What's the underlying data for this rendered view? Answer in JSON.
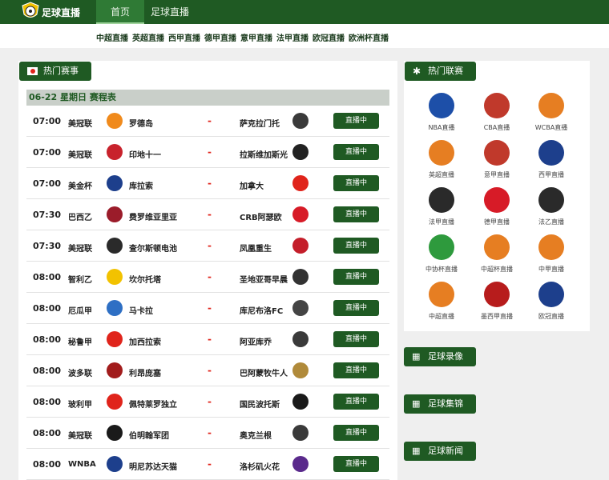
{
  "header": {
    "logo_text": "足球直播",
    "nav": [
      "首页",
      "足球直播"
    ]
  },
  "subnav": [
    "中超直播",
    "英超直播",
    "西甲直播",
    "德甲直播",
    "意甲直播",
    "法甲直播",
    "欧冠直播",
    "欧洲杯直播"
  ],
  "hot_matches": {
    "title": "热门赛事",
    "date": "06-22 星期日 赛程表",
    "live_label": "直播中",
    "rows": [
      {
        "time": "07:00",
        "league": "美冠联",
        "home": "罗德岛",
        "away": "萨克拉门托",
        "hcolor": "#f08a1c",
        "acolor": "#3a3a3a"
      },
      {
        "time": "07:00",
        "league": "美冠联",
        "home": "印地十一",
        "away": "拉斯维加斯光",
        "hcolor": "#c8222c",
        "acolor": "#222222"
      },
      {
        "time": "07:00",
        "league": "美金杯",
        "home": "库拉索",
        "away": "加拿大",
        "hcolor": "#1d3f8c",
        "acolor": "#e0241b"
      },
      {
        "time": "07:30",
        "league": "巴西乙",
        "home": "费罗维亚里亚",
        "away": "CRB阿瑟欧",
        "hcolor": "#9b1c2a",
        "acolor": "#d71b27"
      },
      {
        "time": "07:30",
        "league": "美冠联",
        "home": "查尔斯顿电池",
        "away": "凤凰重生",
        "hcolor": "#2a2a2a",
        "acolor": "#c41e2a"
      },
      {
        "time": "08:00",
        "league": "智利乙",
        "home": "坎尔托塔",
        "away": "圣地亚哥早晨",
        "hcolor": "#f2c200",
        "acolor": "#333333"
      },
      {
        "time": "08:00",
        "league": "厄瓜甲",
        "home": "马卡拉",
        "away": "库尼布洛FC",
        "hcolor": "#2e6fc4",
        "acolor": "#444444"
      },
      {
        "time": "08:00",
        "league": "秘鲁甲",
        "home": "加西拉索",
        "away": "阿亚库乔",
        "hcolor": "#e0241b",
        "acolor": "#3a3a3a"
      },
      {
        "time": "08:00",
        "league": "波多联",
        "home": "利昂庞塞",
        "away": "巴阿蒙牧牛人",
        "hcolor": "#a21c1c",
        "acolor": "#b08a3a"
      },
      {
        "time": "08:00",
        "league": "玻利甲",
        "home": "佩特莱罗独立",
        "away": "国民波托斯",
        "hcolor": "#e0241b",
        "acolor": "#1a1a1a"
      },
      {
        "time": "08:00",
        "league": "美冠联",
        "home": "伯明翰军团",
        "away": "奥克兰根",
        "hcolor": "#1a1a1a",
        "acolor": "#3a3a3a"
      },
      {
        "time": "08:00",
        "league": "WNBA",
        "home": "明尼苏达天猫",
        "away": "洛杉矶火花",
        "hcolor": "#1d3f8c",
        "acolor": "#5a2a8c"
      }
    ]
  },
  "hot_leagues": {
    "title": "热门联赛",
    "items": [
      {
        "label": "NBA直播",
        "color": "#1d4fa8"
      },
      {
        "label": "CBA直播",
        "color": "#c0392b"
      },
      {
        "label": "WCBA直播",
        "color": "#e67e22"
      },
      {
        "label": "英超直播",
        "color": "#e67e22"
      },
      {
        "label": "意甲直播",
        "color": "#c0392b"
      },
      {
        "label": "西甲直播",
        "color": "#1d3f8c"
      },
      {
        "label": "法甲直播",
        "color": "#2a2a2a"
      },
      {
        "label": "德甲直播",
        "color": "#d71b27"
      },
      {
        "label": "法乙直播",
        "color": "#2a2a2a"
      },
      {
        "label": "中协杯直播",
        "color": "#2e9a3d"
      },
      {
        "label": "中超杯直播",
        "color": "#e67e22"
      },
      {
        "label": "中甲直播",
        "color": "#e67e22"
      },
      {
        "label": "中超直播",
        "color": "#e67e22"
      },
      {
        "label": "墨西甲直播",
        "color": "#b71c1c"
      },
      {
        "label": "欧冠直播",
        "color": "#1d3f8c"
      }
    ]
  },
  "side_tags": [
    "足球录像",
    "足球集锦",
    "足球新闻"
  ]
}
